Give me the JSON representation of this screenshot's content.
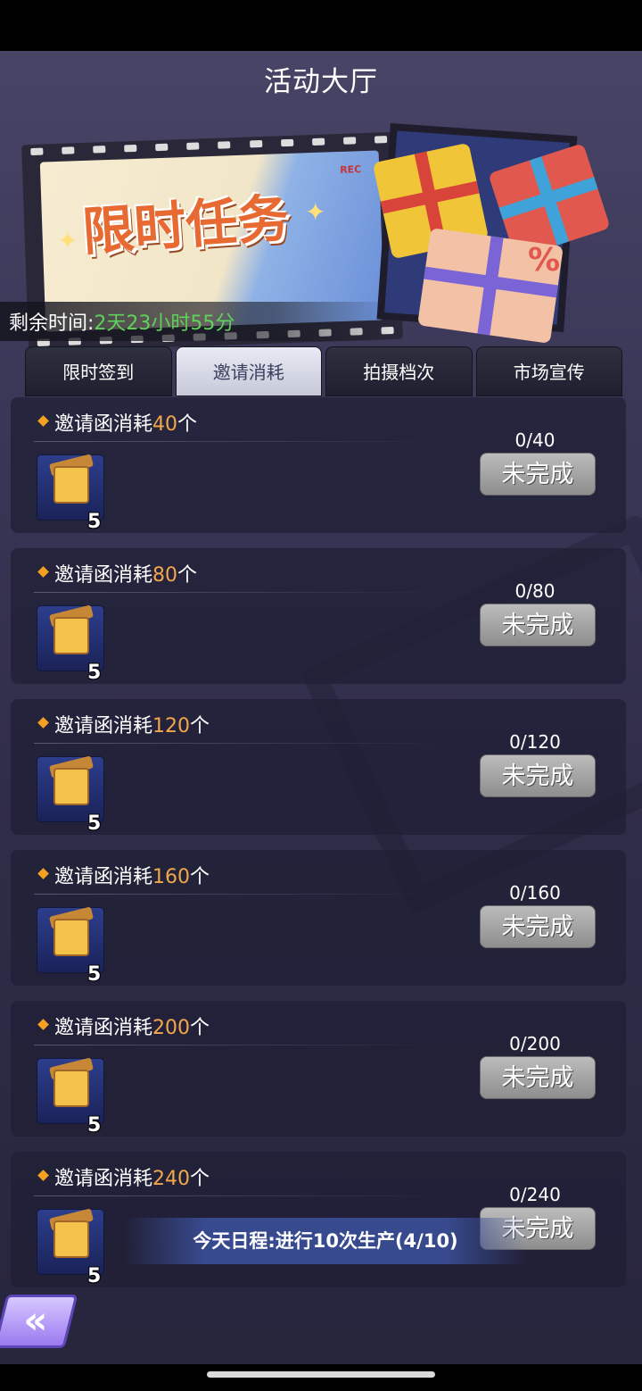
{
  "header": {
    "title": "活动大厅"
  },
  "banner": {
    "headline": "限时任务",
    "rec_label": "REC",
    "timer_label": "剩余时间:",
    "timer_value": "2天23小时55分"
  },
  "tabs": [
    {
      "label": "限时签到",
      "active": false
    },
    {
      "label": "邀请消耗",
      "active": true
    },
    {
      "label": "拍摄档次",
      "active": false
    },
    {
      "label": "市场宣传",
      "active": false
    }
  ],
  "tasks": [
    {
      "prefix": "邀请函消耗",
      "amount": "40",
      "suffix": "个",
      "progress": "0/40",
      "reward_icon": "treasure-chest-icon",
      "reward_count": "5",
      "button": "未完成"
    },
    {
      "prefix": "邀请函消耗",
      "amount": "80",
      "suffix": "个",
      "progress": "0/80",
      "reward_icon": "treasure-chest-icon",
      "reward_count": "5",
      "button": "未完成"
    },
    {
      "prefix": "邀请函消耗",
      "amount": "120",
      "suffix": "个",
      "progress": "0/120",
      "reward_icon": "treasure-chest-icon",
      "reward_count": "5",
      "button": "未完成"
    },
    {
      "prefix": "邀请函消耗",
      "amount": "160",
      "suffix": "个",
      "progress": "0/160",
      "reward_icon": "treasure-chest-icon",
      "reward_count": "5",
      "button": "未完成"
    },
    {
      "prefix": "邀请函消耗",
      "amount": "200",
      "suffix": "个",
      "progress": "0/200",
      "reward_icon": "treasure-chest-icon",
      "reward_count": "5",
      "button": "未完成"
    },
    {
      "prefix": "邀请函消耗",
      "amount": "240",
      "suffix": "个",
      "progress": "0/240",
      "reward_icon": "treasure-chest-icon",
      "reward_count": "5",
      "button": "未完成"
    }
  ],
  "toast": {
    "text": "今天日程:进行10次生产(4/10)"
  },
  "back_button": {
    "icon": "double-chevron-left-icon",
    "glyph": "«"
  },
  "colors": {
    "accent_amount": "#f4a74a",
    "timer_green": "#5fd25a",
    "tab_active_text": "#3b3f5e",
    "button_gray": "#a5a5a5"
  }
}
